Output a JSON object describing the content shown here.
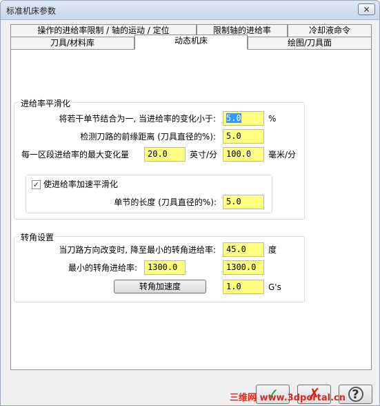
{
  "window": {
    "title": "标准机床参数"
  },
  "tabs": {
    "row_top": [
      "操作的进给率限制 / 轴的运动 / 定位",
      "限制轴的进给率",
      "冷却液命令"
    ],
    "row_bottom": [
      "刀具/材料库",
      "动态机床",
      "绘图/刀具面"
    ],
    "active": "动态机床"
  },
  "feed_smoothing": {
    "title": "进给率平滑化",
    "combine_label": "将若干单节结合为一, 当进给率的变化小于:",
    "combine_value": "5.0",
    "combine_unit": "%",
    "lookahead_label": "检测刀路的前缘距离 (刀具直径的%):",
    "lookahead_value": "5.0",
    "max_change_label": "每一区段进给率的最大变化量",
    "max_change_inch": "20.0",
    "inch_unit": "英寸/分",
    "max_change_mm": "100.0",
    "mm_unit": "毫米/分",
    "accel_checkbox_label": "使进给率加速平滑化",
    "accel_checked": true,
    "segment_label": "单节的长度 (刀具直径的%):",
    "segment_value": "5.0"
  },
  "corner": {
    "title": "转角设置",
    "reduce_label": "当刀路方向改变时, 降至最小的转角进给率:",
    "reduce_value": "45.0",
    "reduce_unit": "度",
    "min_feed_label": "最小的转角进给率:",
    "min_feed_value1": "1300.0",
    "min_feed_value2": "1300.0",
    "accel_button": "转角加速度",
    "accel_value": "1.0",
    "accel_unit": "G's"
  },
  "bottom": {
    "ok": "✓",
    "cancel": "✗",
    "help": "?",
    "watermark": "三维网 www.3dportal.cn"
  }
}
